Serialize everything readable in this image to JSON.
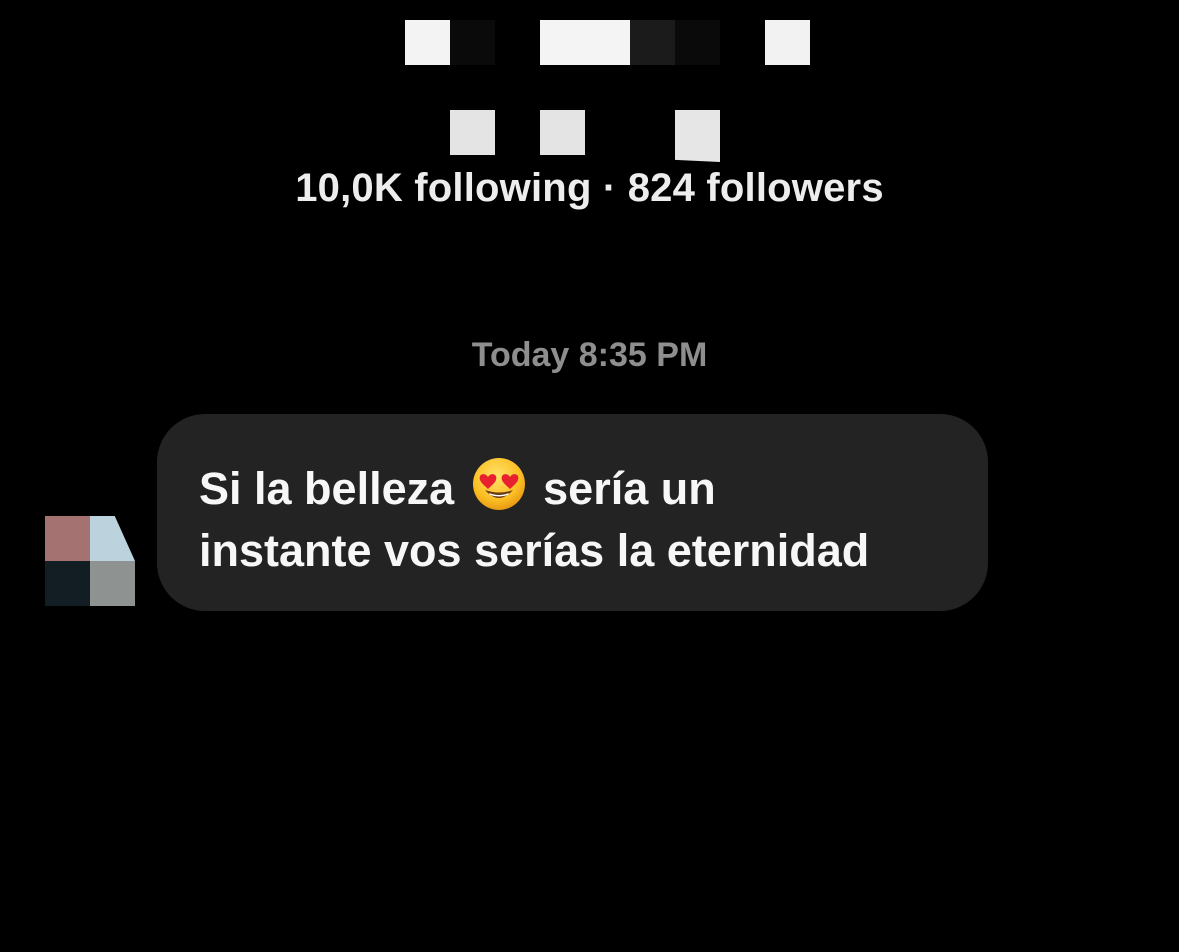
{
  "profile": {
    "stats_text": "10,0K following · 824 followers"
  },
  "chat": {
    "timestamp": "Today 8:35 PM",
    "message": {
      "text_before_emoji": "Si la belleza",
      "emoji_icon": "heart-eyes-emoji",
      "text_after_emoji": "sería un",
      "line2": "instante vos serías la eternidad"
    }
  },
  "colors": {
    "background": "#000000",
    "bubble": "#232323",
    "timestamp": "#8e8e8e",
    "text": "#f7f7f7"
  }
}
